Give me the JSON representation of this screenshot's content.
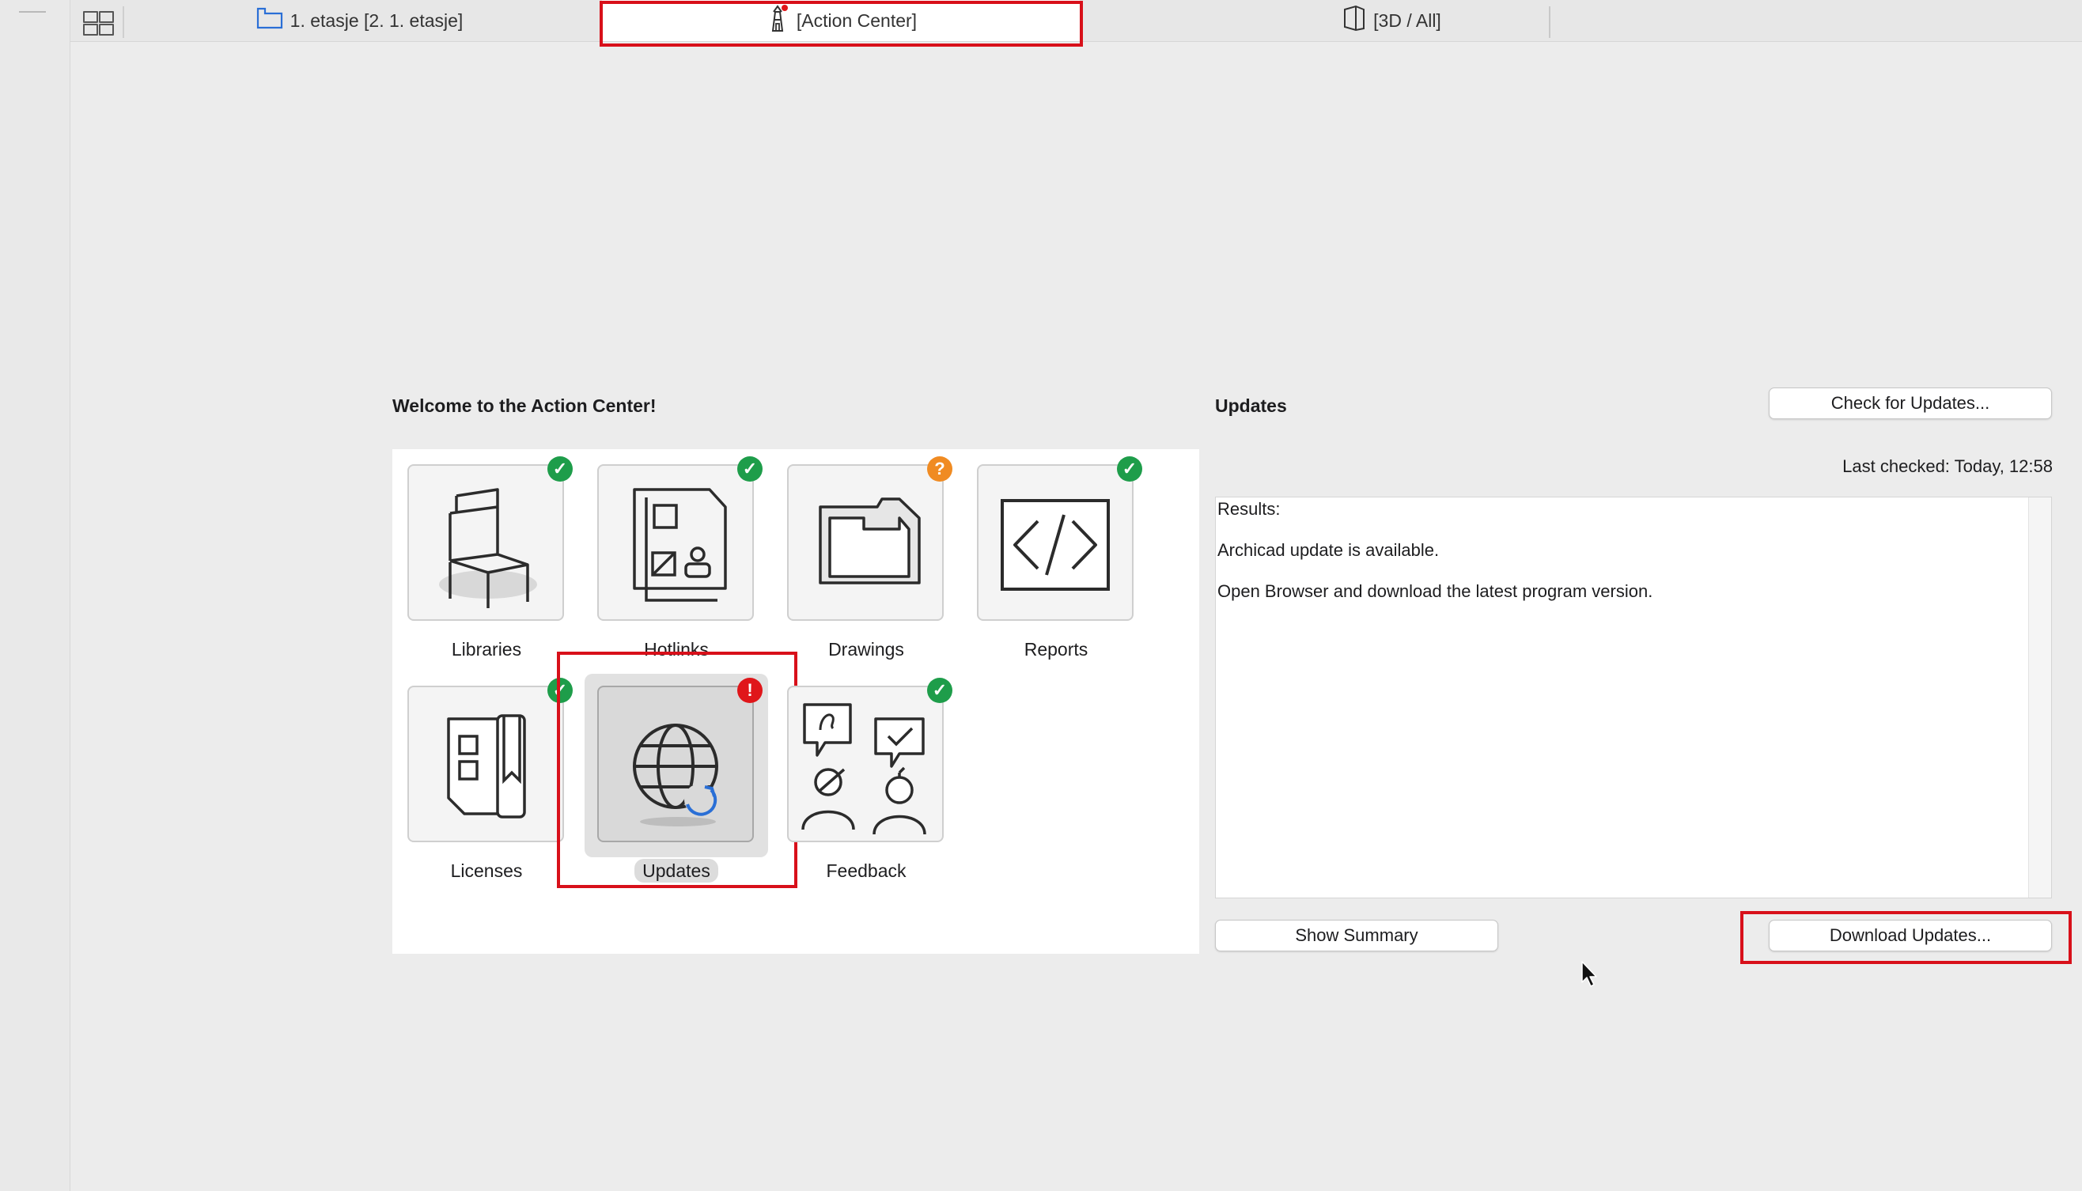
{
  "tabs": [
    {
      "label": "1. etasje [2. 1. etasje]",
      "icon": "floor-plan-icon"
    },
    {
      "label": "[Action Center]",
      "icon": "lighthouse-icon",
      "active": true
    },
    {
      "label": "[3D / All]",
      "icon": "3d-view-icon"
    }
  ],
  "action_center": {
    "welcome": "Welcome to the Action Center!",
    "tiles": [
      {
        "label": "Libraries",
        "icon": "chair-icon",
        "status": "ok"
      },
      {
        "label": "Hotlinks",
        "icon": "hotlinks-icon",
        "status": "ok"
      },
      {
        "label": "Drawings",
        "icon": "drawing-icon",
        "status": "warning"
      },
      {
        "label": "Reports",
        "icon": "code-icon",
        "status": "ok"
      },
      {
        "label": "Licenses",
        "icon": "license-icon",
        "status": "ok"
      },
      {
        "label": "Updates",
        "icon": "globe-update-icon",
        "status": "error"
      },
      {
        "label": "Feedback",
        "icon": "feedback-icon",
        "status": "ok"
      }
    ],
    "badge_symbols": {
      "ok": "✓",
      "warning": "?",
      "error": "!"
    }
  },
  "updates": {
    "title": "Updates",
    "check_button": "Check for Updates...",
    "last_checked": "Last checked: Today, 12:58",
    "results": [
      "Results:",
      "Archicad update is available.",
      "Open Browser and download the latest program version."
    ],
    "show_summary_button": "Show Summary",
    "download_button": "Download Updates..."
  },
  "colors": {
    "ok": "#1e9d4a",
    "warning": "#f08b22",
    "error": "#e0161a",
    "highlight": "#d8101a",
    "accent_blue": "#2a6fd6"
  }
}
